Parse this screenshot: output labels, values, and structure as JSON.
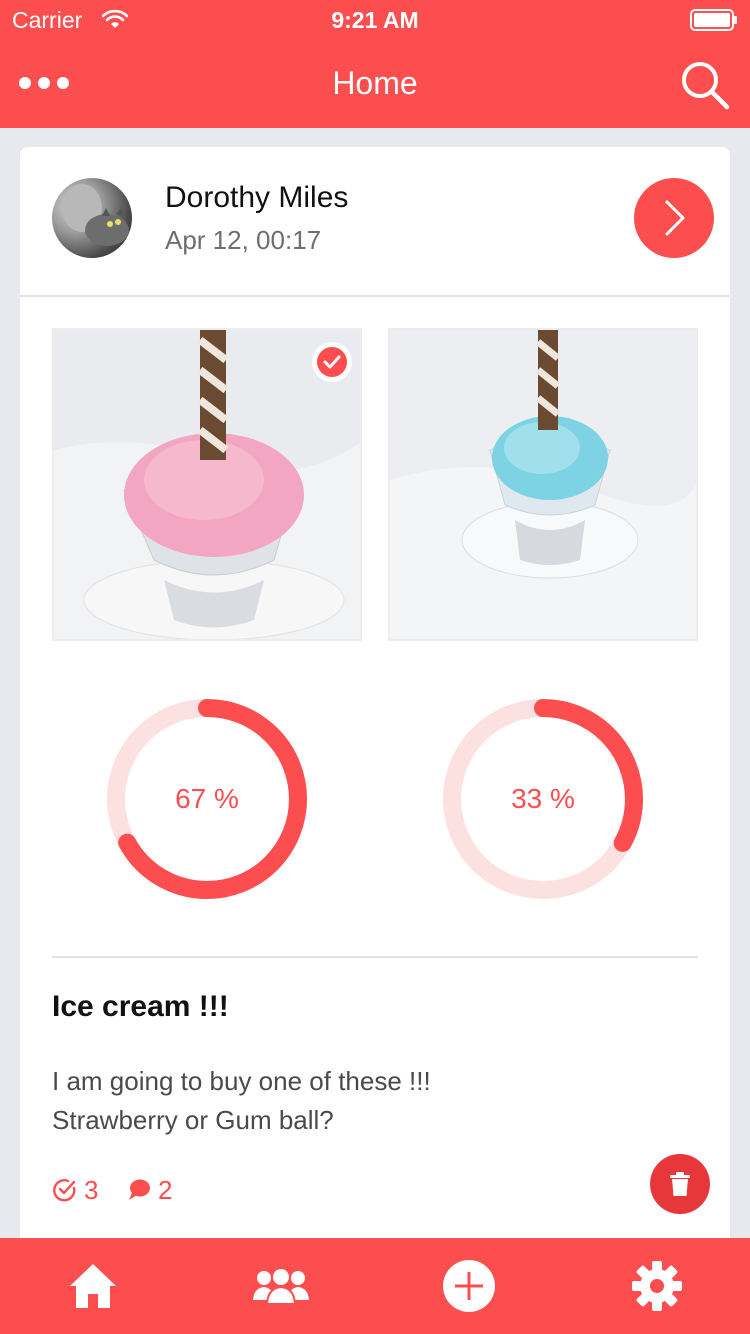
{
  "status_bar": {
    "carrier": "Carrier",
    "time": "9:21 AM"
  },
  "nav": {
    "title": "Home",
    "left_icon": "more-dots-icon",
    "right_icon": "search-icon"
  },
  "post": {
    "author": "Dorothy Miles",
    "date": "Apr 12, 00:17",
    "options": [
      {
        "name": "Strawberry",
        "selected": true,
        "percent_label": "67 %",
        "percent": 67
      },
      {
        "name": "Gum ball",
        "selected": false,
        "percent_label": "33 %",
        "percent": 33
      }
    ],
    "title": "Ice cream !!!",
    "body_line1": "I am going to buy one of these !!!",
    "body_line2": "Strawberry or Gum ball?",
    "votes": "3",
    "comments": "2"
  },
  "tabs": [
    {
      "icon": "home-icon"
    },
    {
      "icon": "friends-icon"
    },
    {
      "icon": "add-icon"
    },
    {
      "icon": "settings-icon"
    }
  ],
  "colors": {
    "accent": "#fd4e4f",
    "ring_track": "#fde0e0",
    "delete": "#e8373a",
    "background": "#e8e9ee"
  }
}
